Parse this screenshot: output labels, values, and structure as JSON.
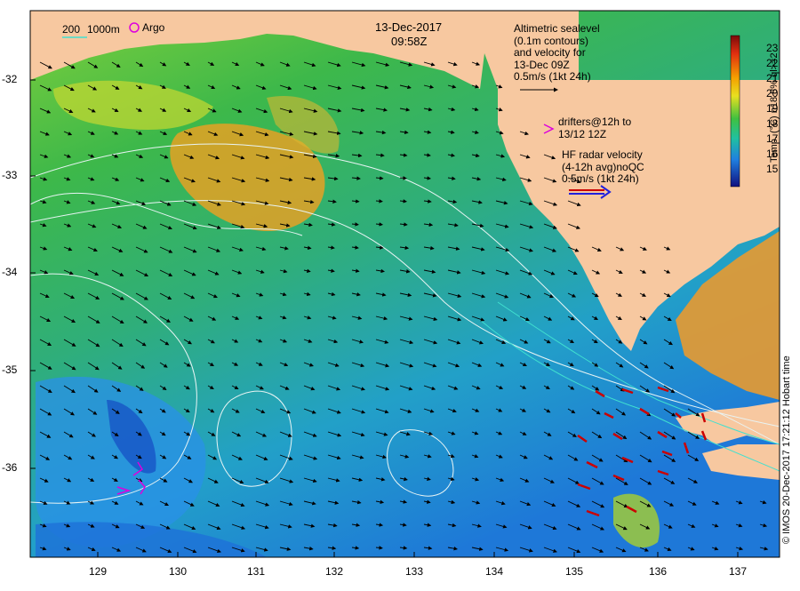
{
  "map": {
    "date": "13-Dec-2017",
    "time": "09:58Z",
    "x_ticks": [
      "129",
      "130",
      "131",
      "132",
      "133",
      "134",
      "135",
      "136",
      "137"
    ],
    "y_ticks": [
      "-32",
      "-33",
      "-34",
      "-35",
      "-36"
    ],
    "colors": {
      "land": "#f7c8a0",
      "sea_cool": "#1e8fe0",
      "sea_mid": "#3dbf6a",
      "sea_warm": "#e8c830",
      "contour": "#e8f4f4",
      "drifter": "#dd00dd",
      "hf_radar": "#cc0000"
    }
  },
  "legend": {
    "contour_200": "200",
    "contour_1000": "1000m",
    "argo": "Argo",
    "altimetric": "Altimetric sealevel\n(0.1m contours)\nand velocity for\n13-Dec 09Z\n0.5m/s (1kt 24h)",
    "drifters": "drifters@12h to\n13/12 12Z",
    "hf_radar": "HF radar velocity\n(4-12h avg)noQC\n0.5m/s (1kt 24h)"
  },
  "colorbar": {
    "ticks": [
      "23",
      "22",
      "21",
      "20",
      "19",
      "18",
      "17",
      "16",
      "15"
    ],
    "label": "Temp. (°C) n18 8% ql>=2"
  },
  "credit": "© IMOS 20-Dec-2017 17:21:12 Hobart time"
}
